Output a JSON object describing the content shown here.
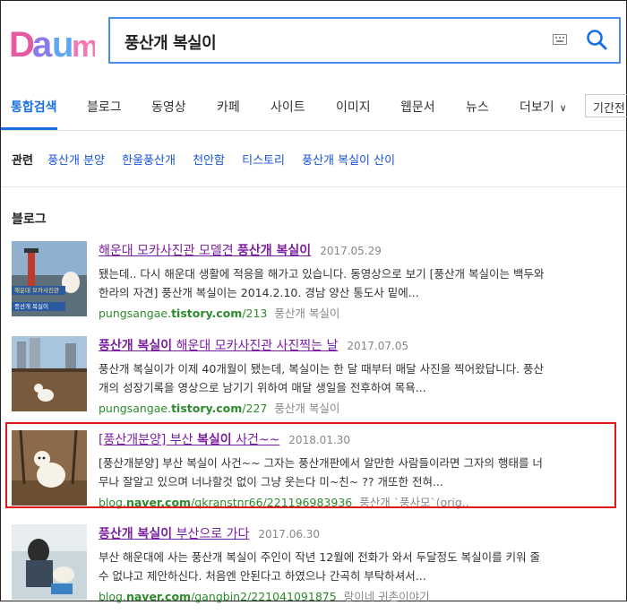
{
  "search": {
    "query": "풍산개 복실이"
  },
  "tabs": [
    {
      "label": "통합검색"
    },
    {
      "label": "블로그"
    },
    {
      "label": "동영상"
    },
    {
      "label": "카페"
    },
    {
      "label": "사이트"
    },
    {
      "label": "이미지"
    },
    {
      "label": "웹문서"
    },
    {
      "label": "뉴스"
    },
    {
      "label": "더보기"
    }
  ],
  "period_label": "기간전",
  "related": {
    "label": "관련",
    "items": [
      "풍산개 분양",
      "한울풍산개",
      "천안함",
      "티스토리",
      "풍산개 복실이 산이"
    ]
  },
  "section_title": "블로그",
  "results": [
    {
      "title_pre": "해운대 모카사진관 모델견 ",
      "title_bold": "풍산개 복실이",
      "title_post": "",
      "date": "2017.05.29",
      "line1": "됐는데.. 다시 해운대 생활에 적응을 해가고 있습니다. 동영상으로 보기 [풍산개 복실이는 백두와",
      "line2": "한라의 자견] 풍산개 복실이는 2014.2.10. 경남 양산 통도사 밑에...",
      "url_host_pre": "pungsangae.",
      "url_host_bold": "tistory.com",
      "url_path": "/213",
      "blog": "풍산개 복실이",
      "thumb_text1": "해운대 모카사진관",
      "thumb_text2": "풍산개 복실이"
    },
    {
      "title_pre": "",
      "title_bold": "풍산개 복실이",
      "title_post": " 해운대 모카사진관 사진찍는 날",
      "date": "2017.07.05",
      "line1": "풍산개 복실이가 이제 40개월이 됐는데, 복실이는 한 달 때부터 매달 사진을 찍어왔답니다. 풍산",
      "line2": "개의 성장기록을 영상으로 남기기 위하여 매달 생일을 전후하여 목욕...",
      "url_host_pre": "pungsangae.",
      "url_host_bold": "tistory.com",
      "url_path": "/227",
      "blog": "풍산개 복실이"
    },
    {
      "title_pre": "[풍산개분양] 부산 ",
      "title_bold": "복실이",
      "title_post": " 사건~~",
      "date": "2018.01.30",
      "line1": "[풍산개분양] 부산 복실이 사건~~ 그자는 풍산개판에서 알만한 사람들이라면 그자의 행태를 너",
      "line2": "무나 잘알고 있으며 너나할것 없이 그냥 웃는다 미~친~ ?? 개또한 전혀...",
      "url_host_pre": "blog.",
      "url_host_bold": "naver.com",
      "url_path": "/qkranstnr66/221196983936",
      "blog": "풍산개 `풍사모`(orig.."
    },
    {
      "title_pre": "",
      "title_bold": "풍산개 복실이",
      "title_post": " 부산으로 가다",
      "date": "2017.06.30",
      "line1": "부산 해운대에 사는 풍산개 복실이 주인이 작년 12월에 전화가 와서 두달정도 복실이를 키워 줄",
      "line2": "수 없냐고 제안하신다. 처음엔 안된다고 하였으나 간곡히 부탁하셔서...",
      "url_host_pre": "blog.",
      "url_host_bold": "naver.com",
      "url_path": "/gangbin2/221041091875",
      "blog": "랑이네 귀촌이야기"
    }
  ],
  "icons": {
    "logo": "daum-logo",
    "keyboard": "keyboard-icon",
    "search": "search-icon"
  },
  "colors": {
    "accent": "#1a6fe0",
    "visited_title": "#7b1fa2",
    "url": "#2d8a2d",
    "highlight": "#e01818"
  }
}
